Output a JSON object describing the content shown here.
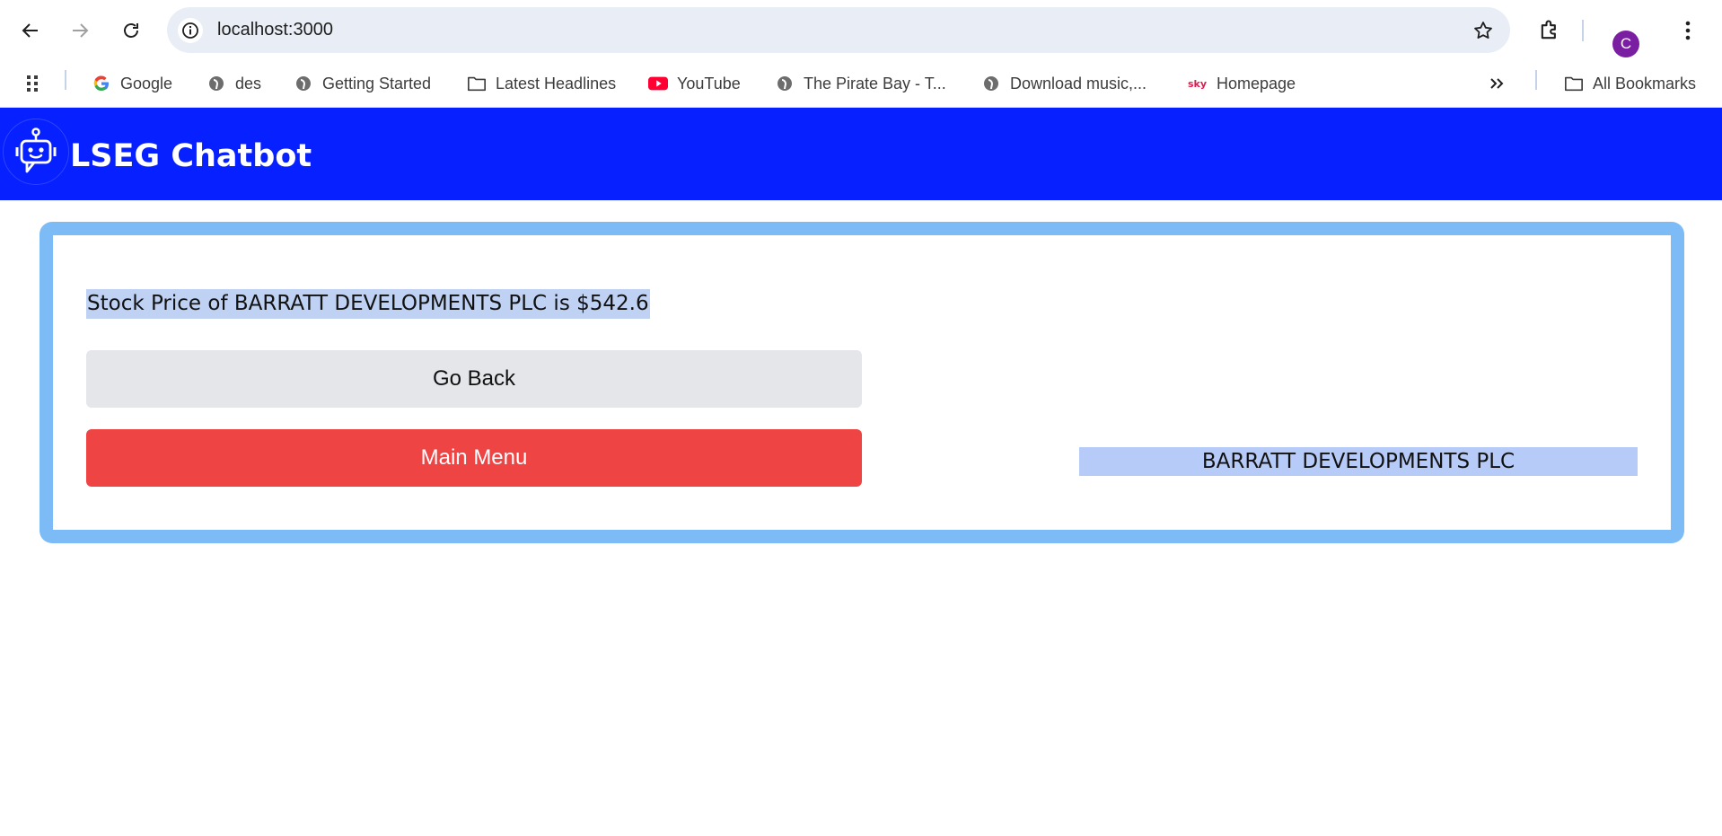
{
  "browser": {
    "url": "localhost:3000",
    "profile_initial": "C",
    "bookmarks": [
      {
        "label": "Google",
        "icon": "google-icon"
      },
      {
        "label": "des",
        "icon": "globe-icon"
      },
      {
        "label": "Getting Started",
        "icon": "globe-icon"
      },
      {
        "label": "Latest Headlines",
        "icon": "folder-icon"
      },
      {
        "label": "YouTube",
        "icon": "youtube-icon"
      },
      {
        "label": "The Pirate Bay - T...",
        "icon": "globe-icon"
      },
      {
        "label": "Download music,...",
        "icon": "globe-icon"
      },
      {
        "label": "Homepage",
        "icon": "sky-icon"
      }
    ],
    "all_bookmarks_label": "All Bookmarks",
    "colors": {
      "omnibox": "#e9eef6",
      "avatar": "#7b1fa2"
    }
  },
  "app": {
    "title": "LSEG Chatbot",
    "stock_message": "Stock Price of BARRATT DEVELOPMENTS PLC is $542.6",
    "go_back_label": "Go Back",
    "main_menu_label": "Main Menu",
    "company_name": "BARRATT DEVELOPMENTS PLC",
    "colors": {
      "header": "#0620ff",
      "card_border": "#7dbbf7",
      "go_back": "#e5e6e9",
      "main_menu": "#ef4444",
      "highlight": "#b7cbf8"
    }
  }
}
